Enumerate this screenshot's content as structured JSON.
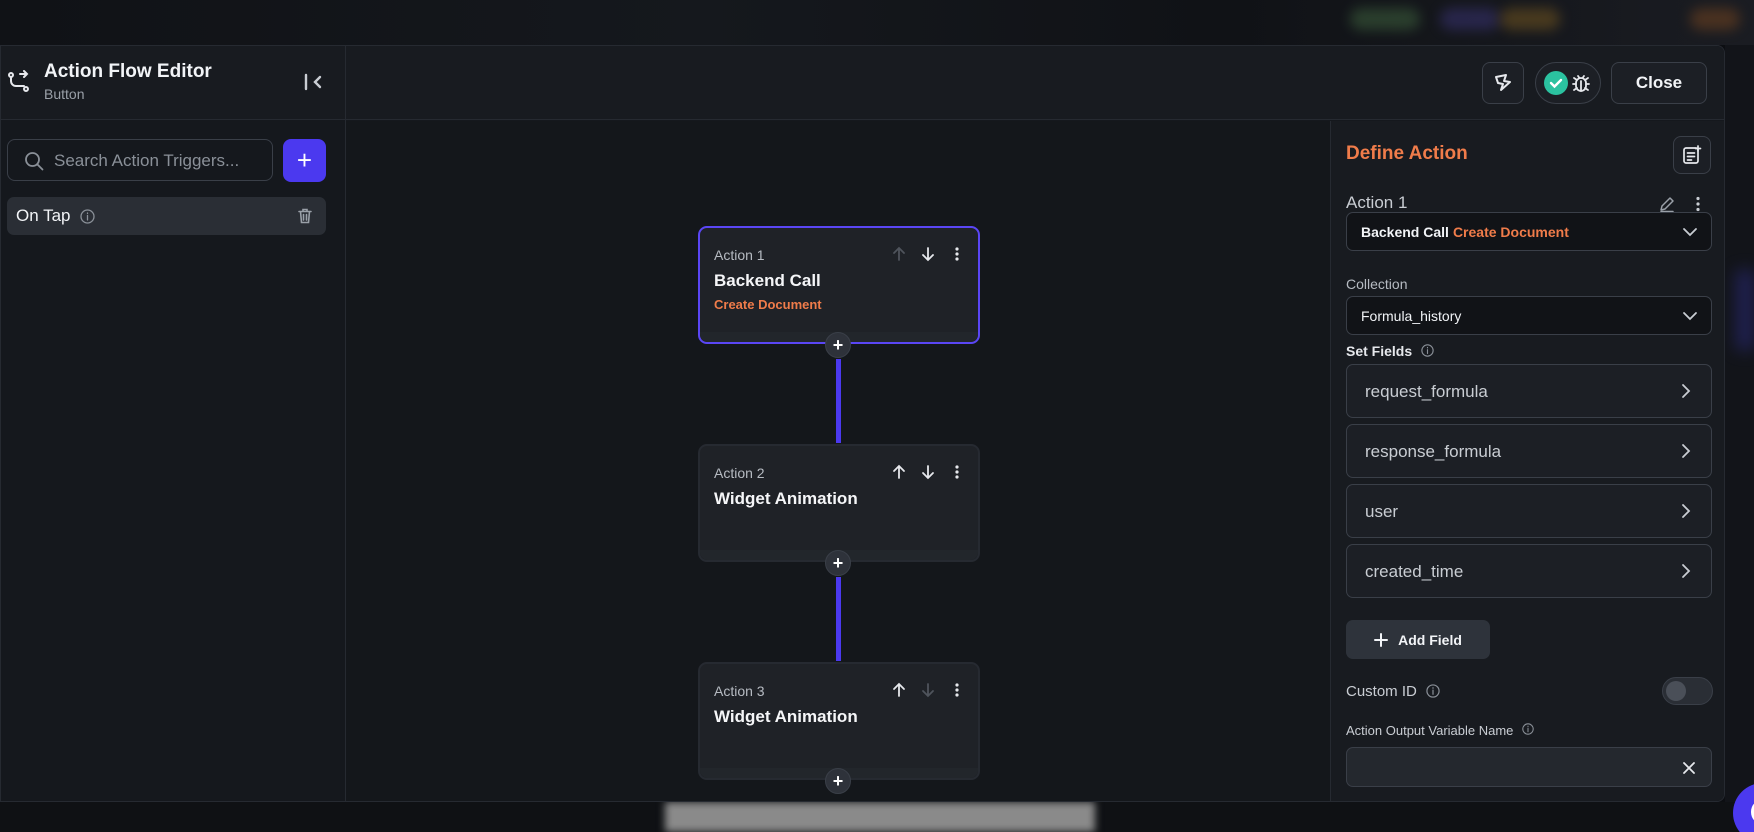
{
  "colors": {
    "accent": "#4b39ef",
    "orange": "#f07c4a",
    "success": "#2bc2a0"
  },
  "header": {
    "title": "Action Flow Editor",
    "subtitle": "Button",
    "close_label": "Close"
  },
  "left": {
    "search_placeholder": "Search Action Triggers...",
    "add_label": "+",
    "triggers": [
      {
        "label": "On Tap"
      }
    ]
  },
  "canvas": {
    "nodes": [
      {
        "number": "Action 1",
        "name": "Backend Call",
        "detail": "Create Document"
      },
      {
        "number": "Action 2",
        "name": "Widget Animation",
        "detail": ""
      },
      {
        "number": "Action 3",
        "name": "Widget Animation",
        "detail": ""
      }
    ],
    "add_label": "+"
  },
  "right": {
    "title": "Define Action",
    "action_label": "Action 1",
    "action_type": {
      "primary": "Backend Call",
      "secondary": "Create Document"
    },
    "collection_label": "Collection",
    "collection_value": "Formula_history",
    "set_fields_label": "Set Fields",
    "fields": [
      "request_formula",
      "response_formula",
      "user",
      "created_time"
    ],
    "add_field_label": "Add Field",
    "custom_id_label": "Custom ID",
    "custom_id_enabled": false,
    "output_var_label": "Action Output Variable Name",
    "output_var_value": ""
  }
}
